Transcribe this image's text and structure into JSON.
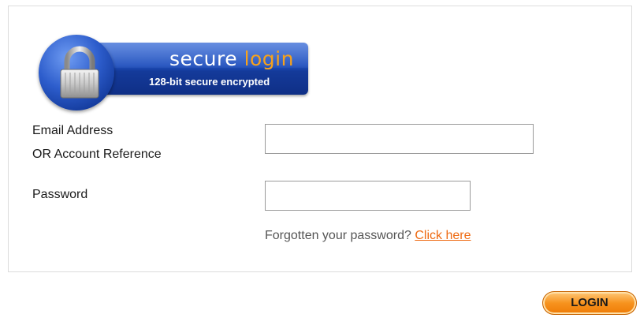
{
  "badge": {
    "title_word1": "secure",
    "title_word2": "login",
    "subtitle": "128-bit secure encrypted",
    "icon": "padlock-icon"
  },
  "form": {
    "email_label_line1": "Email Address",
    "email_label_line2": "OR Account Reference",
    "email_value": "",
    "password_label": "Password",
    "password_value": "",
    "forgot_text": "Forgotten your password?",
    "forgot_link": "Click here"
  },
  "actions": {
    "login_label": "LOGIN"
  },
  "colors": {
    "badge_blue": "#1f4fbd",
    "accent_orange": "#f7931e",
    "link_orange": "#ee6a12"
  }
}
